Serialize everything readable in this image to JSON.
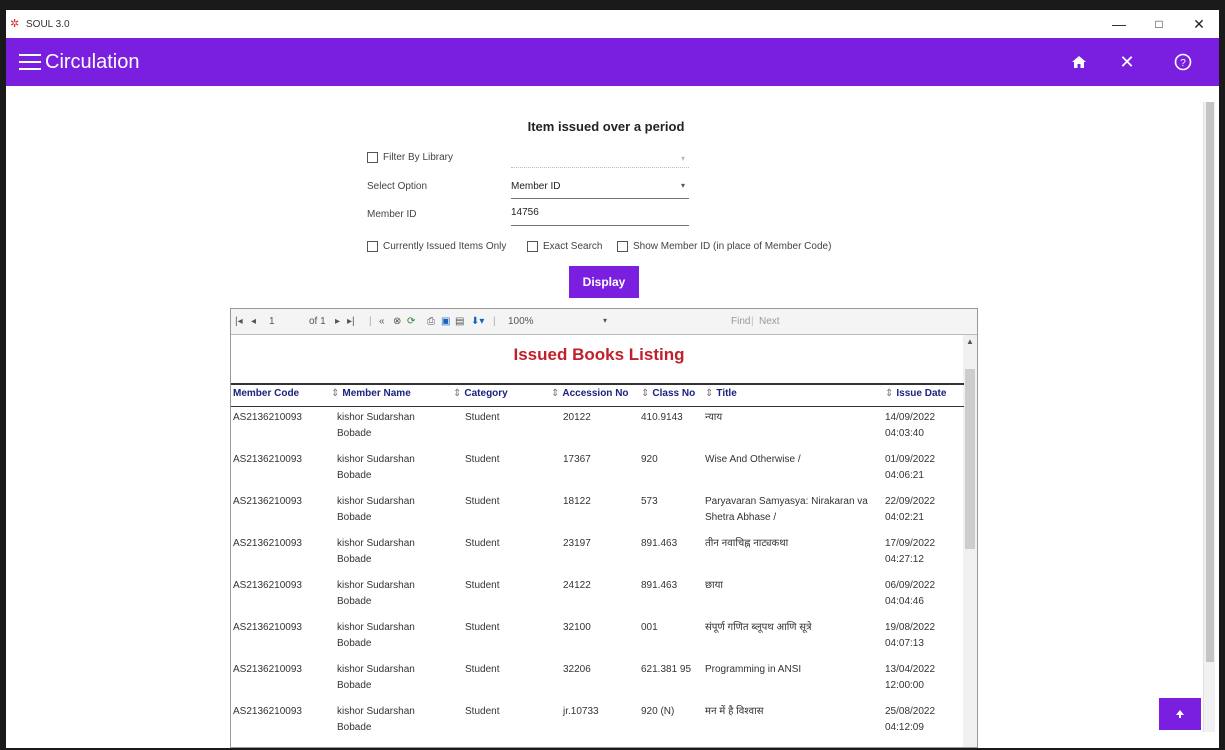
{
  "window": {
    "title": "SOUL 3.0",
    "minimize": "—",
    "maximize": "□",
    "close": "✕"
  },
  "appbar": {
    "title": "Circulation",
    "home_icon": "⌂",
    "close_icon": "✕",
    "help_icon": "?"
  },
  "form": {
    "page_title": "Item issued over a period",
    "filter_by_library_label": "Filter By Library",
    "select_option_label": "Select Option",
    "select_option_value": "Member ID",
    "member_id_label": "Member ID",
    "member_id_value": "14756",
    "currently_issued_label": "Currently Issued Items Only",
    "exact_search_label": "Exact Search",
    "show_member_id_label": "Show Member ID (in place of Member Code)",
    "display_button": "Display"
  },
  "report_toolbar": {
    "page_current": "1",
    "page_of": "of 1",
    "zoom": "100%",
    "find_label": "Find",
    "next_label": "Next"
  },
  "report": {
    "title": "Issued Books Listing",
    "columns": [
      "Member Code",
      "Member Name",
      "Category",
      "Accession No",
      "Class No",
      "Title",
      "Issue Date"
    ],
    "rows": [
      {
        "code": "AS2136210093",
        "name": "kishor Sudarshan Bobade",
        "category": "Student",
        "accession": "20122",
        "class": "410.9143",
        "title": "न्याय",
        "date": "14/09/2022 04:03:40"
      },
      {
        "code": "AS2136210093",
        "name": "kishor Sudarshan Bobade",
        "category": "Student",
        "accession": "17367",
        "class": "920",
        "title": "Wise And Otherwise /",
        "date": "01/09/2022 04:06:21"
      },
      {
        "code": "AS2136210093",
        "name": "kishor Sudarshan Bobade",
        "category": "Student",
        "accession": "18122",
        "class": "573",
        "title": "Paryavaran Samyasya: Nirakaran va Shetra Abhase /",
        "date": "22/09/2022 04:02:21"
      },
      {
        "code": "AS2136210093",
        "name": "kishor Sudarshan Bobade",
        "category": "Student",
        "accession": "23197",
        "class": "891.463",
        "title": "तीन नवाचिह्न नाट्यकथा",
        "date": "17/09/2022 04:27:12"
      },
      {
        "code": "AS2136210093",
        "name": "kishor Sudarshan Bobade",
        "category": "Student",
        "accession": "24122",
        "class": "891.463",
        "title": "छाया",
        "date": "06/09/2022 04:04:46"
      },
      {
        "code": "AS2136210093",
        "name": "kishor Sudarshan Bobade",
        "category": "Student",
        "accession": "32100",
        "class": "001",
        "title": "संपूर्ण गणित ब्लूपथ आणि सूत्रे",
        "date": "19/08/2022 04:07:13"
      },
      {
        "code": "AS2136210093",
        "name": "kishor Sudarshan Bobade",
        "category": "Student",
        "accession": "32206",
        "class": "621.381 95",
        "title": "Programming in ANSI",
        "date": "13/04/2022 12:00:00"
      },
      {
        "code": "AS2136210093",
        "name": "kishor Sudarshan Bobade",
        "category": "Student",
        "accession": "jr.10733",
        "class": "920 (N)",
        "title": "मन में है विश्वास",
        "date": "25/08/2022 04:12:09"
      }
    ]
  },
  "colors": {
    "accent": "#7a1fe0",
    "report_title": "#c0202a",
    "header_text": "#1a237e"
  }
}
